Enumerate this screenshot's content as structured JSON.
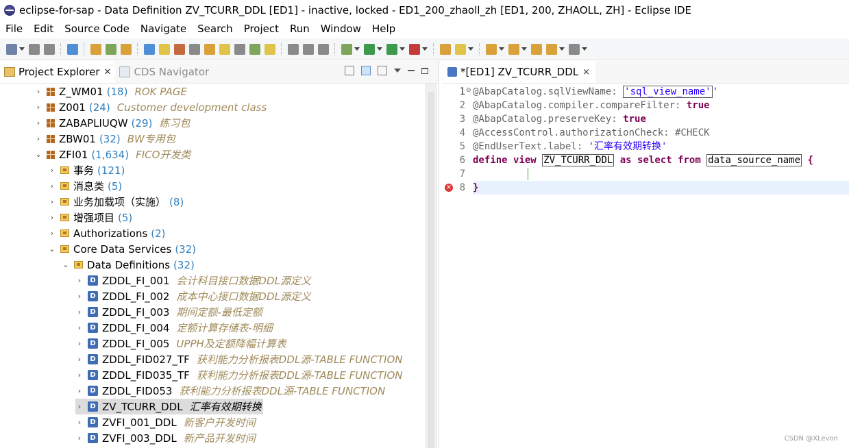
{
  "window": {
    "title": "eclipse-for-sap - Data Definition ZV_TCURR_DDL [ED1] - inactive, locked - ED1_200_zhaoll_zh [ED1, 200, ZHAOLL, ZH] - Eclipse IDE"
  },
  "menu": [
    "File",
    "Edit",
    "Source Code",
    "Navigate",
    "Search",
    "Project",
    "Run",
    "Window",
    "Help"
  ],
  "project_explorer": {
    "tabs": [
      {
        "label": "Project Explorer",
        "active": true
      },
      {
        "label": "CDS Navigator",
        "active": false
      }
    ],
    "tree": [
      {
        "label": "Z_WM01",
        "count": "(18)",
        "desc": "ROK PAGE",
        "level": 0,
        "chev": ">",
        "icon": "package-icon"
      },
      {
        "label": "Z001",
        "count": "(24)",
        "desc": "Customer development class",
        "level": 0,
        "chev": ">",
        "icon": "package-icon"
      },
      {
        "label": "ZABAPLIUQW",
        "count": "(29)",
        "desc": "练习包",
        "level": 0,
        "chev": ">",
        "icon": "package-icon"
      },
      {
        "label": "ZBW01",
        "count": "(32)",
        "desc": "BW专用包",
        "level": 0,
        "chev": ">",
        "icon": "package-icon"
      },
      {
        "label": "ZFI01",
        "count": "(1,634)",
        "desc": "FICO开发类",
        "level": 0,
        "chev": "v",
        "icon": "package-icon"
      },
      {
        "label": "事务",
        "count": "(121)",
        "desc": "",
        "level": 1,
        "chev": ">",
        "icon": "folder-icon"
      },
      {
        "label": "消息类",
        "count": "(5)",
        "desc": "",
        "level": 1,
        "chev": ">",
        "icon": "folder-icon"
      },
      {
        "label": "业务加载项（实施）",
        "count": "(8)",
        "desc": "",
        "level": 1,
        "chev": ">",
        "icon": "folder-icon"
      },
      {
        "label": "增强项目",
        "count": "(5)",
        "desc": "",
        "level": 1,
        "chev": ">",
        "icon": "folder-icon"
      },
      {
        "label": "Authorizations",
        "count": "(2)",
        "desc": "",
        "level": 1,
        "chev": ">",
        "icon": "folder-icon"
      },
      {
        "label": "Core Data Services",
        "count": "(32)",
        "desc": "",
        "level": 1,
        "chev": "v",
        "icon": "folder-icon"
      },
      {
        "label": "Data Definitions",
        "count": "(32)",
        "desc": "",
        "level": 2,
        "chev": "v",
        "icon": "folder-icon"
      },
      {
        "label": "ZDDL_FI_001",
        "count": "",
        "desc": "会计科目接口数据DDL源定义",
        "level": 3,
        "chev": ">",
        "icon": "ddl-icon"
      },
      {
        "label": "ZDDL_FI_002",
        "count": "",
        "desc": "成本中心接口数据DDL源定义",
        "level": 3,
        "chev": ">",
        "icon": "ddl-icon"
      },
      {
        "label": "ZDDL_FI_003",
        "count": "",
        "desc": "期间定额-最低定额",
        "level": 3,
        "chev": ">",
        "icon": "ddl-icon"
      },
      {
        "label": "ZDDL_FI_004",
        "count": "",
        "desc": "定额计算存储表-明细",
        "level": 3,
        "chev": ">",
        "icon": "ddl-icon"
      },
      {
        "label": "ZDDL_FI_005",
        "count": "",
        "desc": "UPPH及定额降幅计算表",
        "level": 3,
        "chev": ">",
        "icon": "ddl-icon"
      },
      {
        "label": "ZDDL_FID027_TF",
        "count": "",
        "desc": "获利能力分析报表DDL源-TABLE FUNCTION",
        "level": 3,
        "chev": ">",
        "icon": "ddl-icon"
      },
      {
        "label": "ZDDL_FID035_TF",
        "count": "",
        "desc": "获利能力分析报表DDL源-TABLE FUNCTION",
        "level": 3,
        "chev": ">",
        "icon": "ddl-icon"
      },
      {
        "label": "ZDDL_FID053",
        "count": "",
        "desc": "获利能力分析报表DDL源-TABLE FUNCTION",
        "level": 3,
        "chev": ">",
        "icon": "ddl-icon"
      },
      {
        "label": "ZV_TCURR_DDL",
        "count": "",
        "desc": "汇率有效期转换",
        "level": 3,
        "chev": ">",
        "icon": "ddl-icon",
        "selected": true
      },
      {
        "label": "ZVFI_001_DDL",
        "count": "",
        "desc": "新客户开发时间",
        "level": 3,
        "chev": ">",
        "icon": "ddl-icon"
      },
      {
        "label": "ZVFI_003_DDL",
        "count": "",
        "desc": "新产品开发时间",
        "level": 3,
        "chev": ">",
        "icon": "ddl-icon"
      }
    ]
  },
  "editor": {
    "tab_label": "*[ED1] ZV_TCURR_DDL",
    "tab_close": "×",
    "lines": [
      {
        "num": "1",
        "parts": [
          [
            "ann",
            "@AbapCatalog.sqlViewName: "
          ],
          [
            "strbox",
            "'sql_view_name'"
          ],
          [
            "str",
            "'"
          ]
        ]
      },
      {
        "num": "2",
        "parts": [
          [
            "ann",
            "@AbapCatalog.compiler.compareFilter: "
          ],
          [
            "kwp",
            "true"
          ]
        ]
      },
      {
        "num": "3",
        "parts": [
          [
            "ann",
            "@AbapCatalog.preserveKey: "
          ],
          [
            "kwp",
            "true"
          ]
        ]
      },
      {
        "num": "4",
        "parts": [
          [
            "ann",
            "@AccessControl.authorizationCheck: #CHECK"
          ]
        ]
      },
      {
        "num": "5",
        "parts": [
          [
            "ann",
            "@EndUserText.label: "
          ],
          [
            "str",
            "'汇率有效期转换'"
          ]
        ]
      },
      {
        "num": "6",
        "parts": [
          [
            "kw",
            "define view "
          ],
          [
            "box",
            "ZV_TCURR_DDL"
          ],
          [
            "kw",
            " as select from "
          ],
          [
            "box",
            "data_source_name"
          ],
          [
            "txt",
            " "
          ],
          [
            "kw",
            "{"
          ]
        ]
      },
      {
        "num": "7",
        "parts": []
      },
      {
        "num": "8",
        "parts": [
          [
            "kw",
            "}"
          ]
        ]
      }
    ]
  },
  "watermark": "CSDN @XLevon",
  "colors": {
    "keyword": "#7f0055",
    "annotation": "#646464",
    "string": "#2a00ff",
    "count": "#2f7fbf",
    "description": "#a08a5a",
    "current_line": "#e8f2fe",
    "error": "#d93a3a"
  }
}
